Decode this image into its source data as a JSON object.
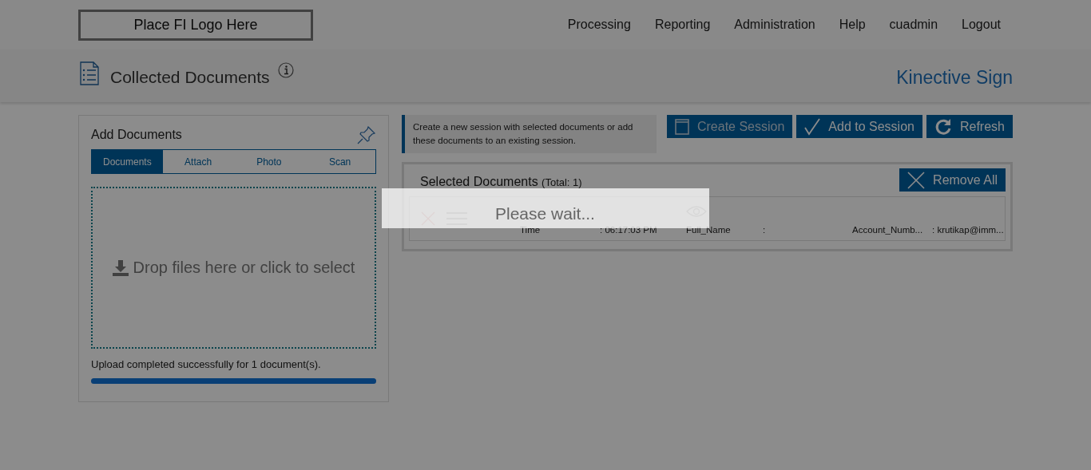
{
  "logo": {
    "text": "Place FI Logo Here"
  },
  "nav": [
    "Processing",
    "Reporting",
    "Administration",
    "Help",
    "cuadmin",
    "Logout"
  ],
  "page_title": "Collected Documents",
  "brand": "Kinective Sign",
  "add_panel": {
    "title": "Add Documents",
    "tabs": [
      {
        "label": "Documents",
        "selected": true
      },
      {
        "label": "Attach",
        "selected": false
      },
      {
        "label": "Photo",
        "selected": false
      },
      {
        "label": "Scan",
        "selected": false
      }
    ],
    "dropzone": "Drop files here or click to select",
    "status": "Upload completed successfully for 1 document(s).",
    "progress": {
      "level": 1
    }
  },
  "hint": "Create a new session with selected documents or add these documents to an existing session.",
  "actions": [
    {
      "kind": "create",
      "label": "Create Session",
      "disabled": true
    },
    {
      "kind": "add",
      "label": "Add to Session",
      "disabled": false
    },
    {
      "kind": "refresh",
      "label": "Refresh",
      "disabled": false
    }
  ],
  "selected": {
    "title": "Selected Documents",
    "total": "(Total: 1)",
    "remove_all": "Remove All",
    "rows": [
      {
        "fields": [
          {
            "label": "Time",
            "value": ": 06:17:03 PM"
          },
          {
            "label": "Full_Name",
            "value": ":"
          },
          {
            "label": "Account_Numb...",
            "value": ": krutikap@imm..."
          }
        ]
      }
    ]
  },
  "loading": {
    "text": "Please wait..."
  }
}
